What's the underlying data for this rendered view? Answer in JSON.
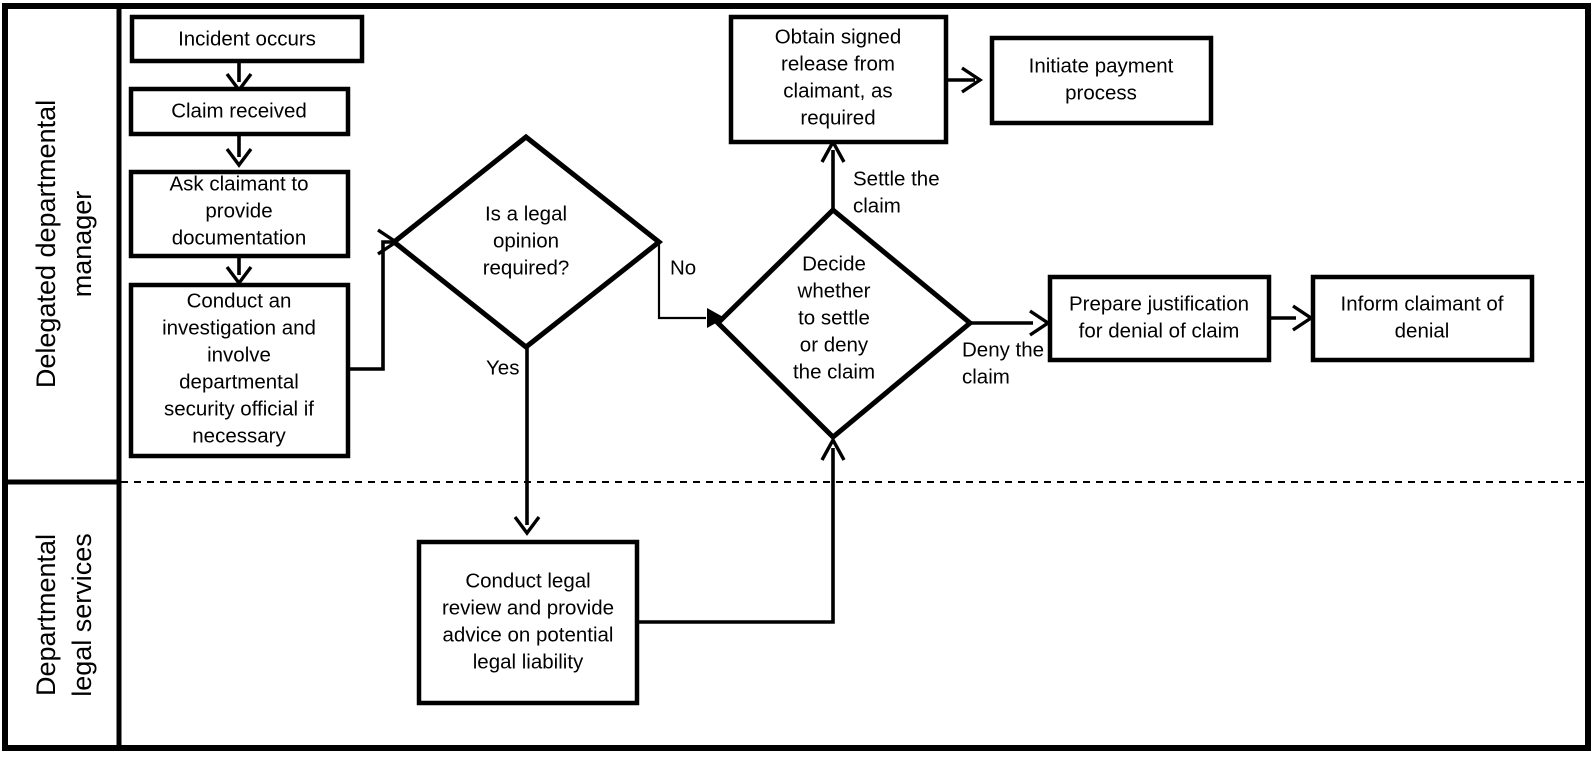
{
  "diagram": {
    "title": "Claims handling swimlane flowchart",
    "type": "swimlane-flowchart",
    "background_color": "#ffffff",
    "line_color": "#000000"
  },
  "lanes": [
    {
      "id": "lane-manager",
      "label": "Delegated departmental manager"
    },
    {
      "id": "lane-legal",
      "label": "Departmental legal services"
    }
  ],
  "nodes": {
    "incident_occurs": {
      "label": "Incident occurs",
      "shape": "process"
    },
    "claim_received": {
      "label": "Claim received",
      "shape": "process"
    },
    "ask_claimant": {
      "shape": "process",
      "lines": [
        "Ask claimant to",
        "provide",
        "documentation"
      ]
    },
    "conduct_investigation": {
      "shape": "process",
      "lines": [
        "Conduct an",
        "investigation and",
        "involve",
        "departmental",
        "security official if",
        "necessary"
      ]
    },
    "legal_opinion_decision": {
      "shape": "decision",
      "lines": [
        "Is a legal",
        "opinion",
        "required?"
      ]
    },
    "conduct_legal_review": {
      "shape": "process",
      "lines": [
        "Conduct legal",
        "review and provide",
        "advice on potential",
        "legal liability"
      ]
    },
    "settle_or_deny_decision": {
      "shape": "decision",
      "lines": [
        "Decide",
        "whether",
        "to settle",
        "or deny",
        "the claim"
      ]
    },
    "obtain_signed_release": {
      "shape": "process",
      "lines": [
        "Obtain signed",
        "release from",
        "claimant, as",
        "required"
      ]
    },
    "initiate_payment": {
      "shape": "process",
      "lines": [
        "Initiate payment",
        "process"
      ]
    },
    "prepare_justification": {
      "shape": "process",
      "lines": [
        "Prepare justification",
        "for denial of claim"
      ]
    },
    "inform_claimant": {
      "shape": "process",
      "lines": [
        "Inform claimant of",
        "denial"
      ]
    }
  },
  "edge_labels": {
    "no": "No",
    "yes": "Yes",
    "settle_the_claim": [
      "Settle the",
      "claim"
    ],
    "deny_the_claim": [
      "Deny the",
      "claim"
    ]
  }
}
